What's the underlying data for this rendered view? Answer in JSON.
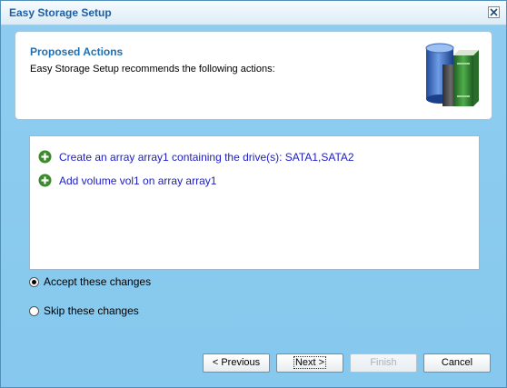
{
  "window": {
    "title": "Easy Storage Setup",
    "close_icon": "close-icon"
  },
  "header": {
    "title": "Proposed Actions",
    "subtitle": "Easy Storage Setup recommends the following actions:",
    "art_icon": "storage-drives-icon"
  },
  "actions": [
    {
      "icon": "plus-icon",
      "label": "Create an array array1 containing the drive(s): SATA1,SATA2"
    },
    {
      "icon": "plus-icon",
      "label": "Add volume vol1 on array array1"
    }
  ],
  "options": [
    {
      "label": "Accept these changes",
      "checked": true
    },
    {
      "label": "Skip these changes",
      "checked": false
    }
  ],
  "buttons": {
    "previous": "< Previous",
    "next": "Next >",
    "finish": "Finish",
    "cancel": "Cancel"
  },
  "colors": {
    "window_bg": "#8ecdf0",
    "title_text": "#1c5fa5",
    "header_title": "#1f6fb3",
    "action_text": "#1c1cc4",
    "plus_icon": "#3d8a2e"
  }
}
